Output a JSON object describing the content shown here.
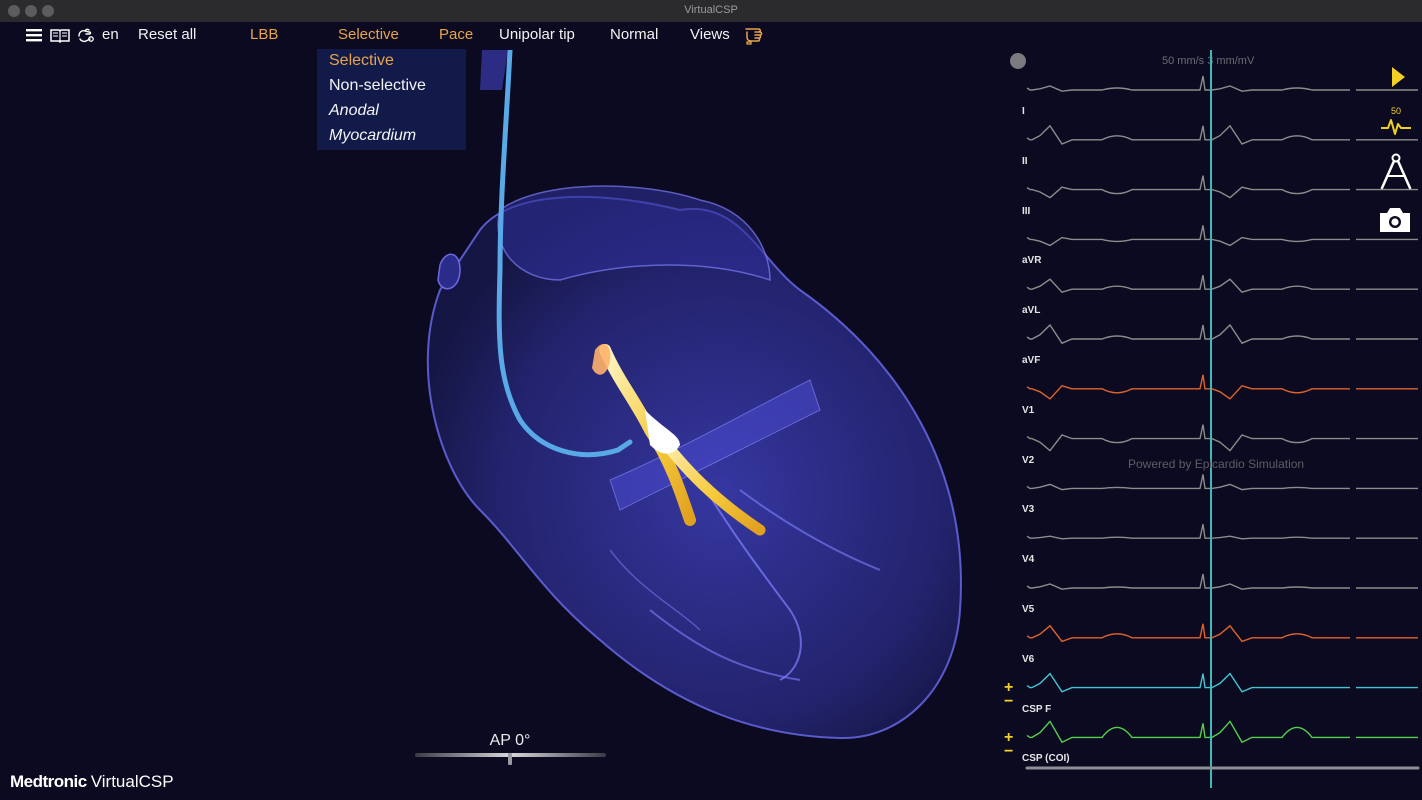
{
  "window": {
    "title": "VirtualCSP"
  },
  "toolbar": {
    "language": "en",
    "reset_label": "Reset all",
    "region": "LBB",
    "capture": "Selective",
    "mode": "Pace",
    "lead_type": "Unipolar tip",
    "speed": "Normal",
    "views": "Views"
  },
  "capture_menu": {
    "options": [
      "Selective",
      "Non-selective",
      "Anodal",
      "Myocardium"
    ]
  },
  "view": {
    "label": "AP 0°",
    "angle_deg": 0
  },
  "brand": {
    "company": "Medtronic",
    "product": "VirtualCSP"
  },
  "ecg": {
    "scale": "50 mm/s  3 mm/mV",
    "powered_by": "Powered by Epicardio Simulation",
    "leads": [
      "I",
      "II",
      "III",
      "aVR",
      "aVL",
      "aVF",
      "V1",
      "V2",
      "V3",
      "V4",
      "V5",
      "V6",
      "CSP F",
      "CSP (COI)"
    ],
    "speed_badge": "50"
  },
  "colors": {
    "accent_orange": "#e8a44a",
    "ecg_grey": "#8c8c8c",
    "ecg_orange": "#e0632a",
    "ecg_cyan": "#43c6d2",
    "ecg_green": "#55d04a",
    "cursor": "#3fb8b8",
    "icon_yellow": "#f2d024"
  },
  "icons": {
    "menu": "hamburger-icon",
    "book": "book-icon",
    "language": "hand-icon",
    "views": "pointing-hand-icon",
    "play": "play-icon",
    "sweep": "ecg-speed-icon",
    "caliper": "caliper-icon",
    "camera": "camera-icon"
  }
}
